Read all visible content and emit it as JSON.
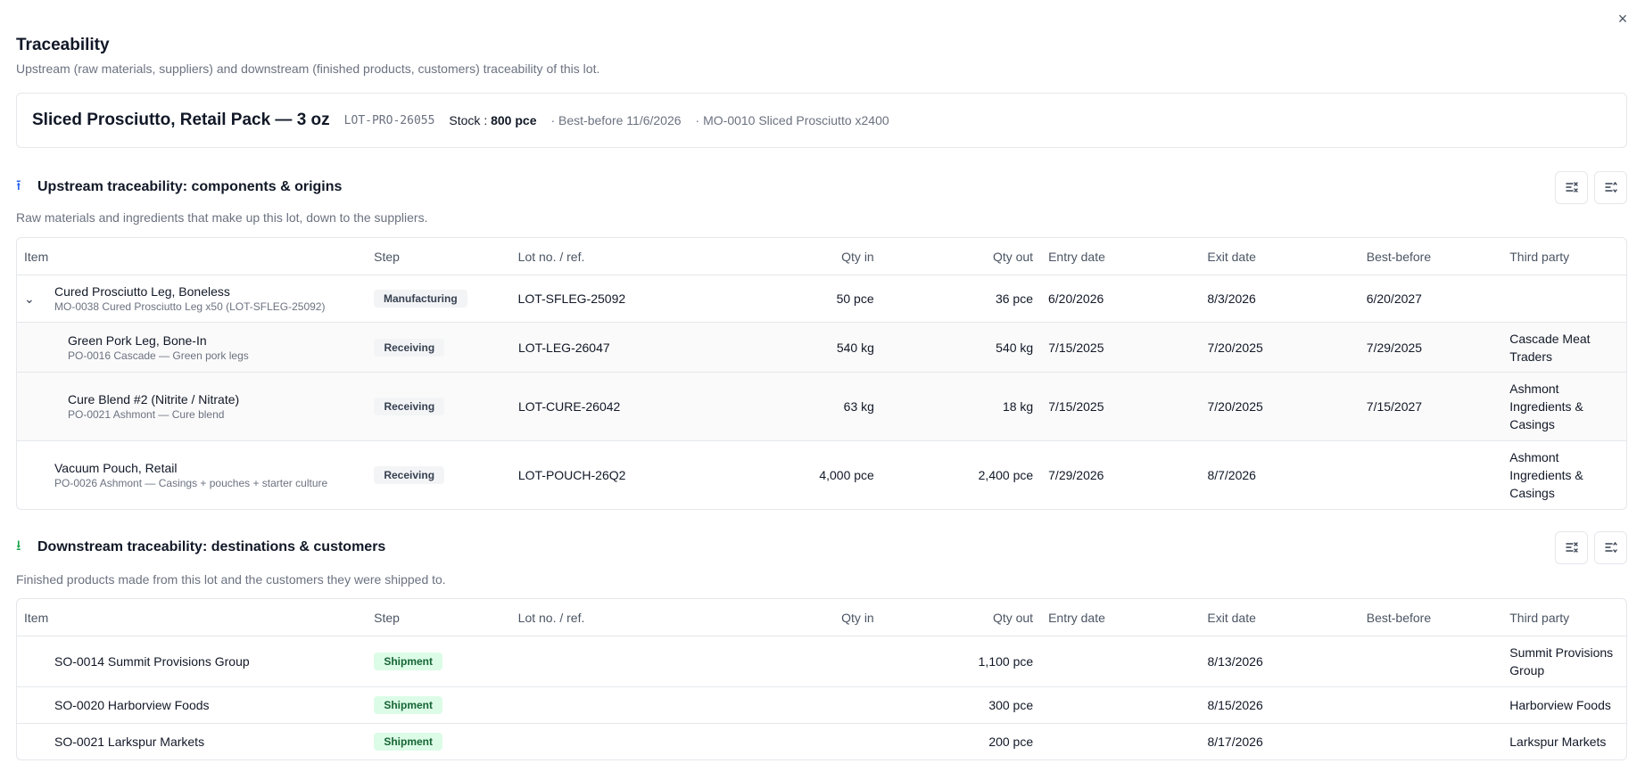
{
  "dialog": {
    "title": "Traceability",
    "subtitle": "Upstream (raw materials, suppliers) and downstream (finished products, customers) traceability of this lot.",
    "close_label": "×"
  },
  "lot": {
    "name": "Sliced Prosciutto, Retail Pack — 3 oz",
    "code": "LOT-PRO-26055",
    "stock_label": "Stock :",
    "stock_value": "800 pce",
    "best_before": "· Best-before 11/6/2026",
    "mo": "· MO-0010 Sliced Prosciutto x2400"
  },
  "columns": {
    "item": "Item",
    "step": "Step",
    "lot": "Lot no. / ref.",
    "qty_in": "Qty in",
    "qty_out": "Qty out",
    "entry": "Entry date",
    "exit": "Exit date",
    "best_before": "Best-before",
    "third_party": "Third party"
  },
  "upstream": {
    "icon": "arrow-up-icon",
    "title": "Upstream traceability: components & origins",
    "desc": "Raw materials and ingredients that make up this lot, down to the suppliers.",
    "rows": [
      {
        "name": "Cured Prosciutto Leg, Boneless",
        "sub": "MO-0038 Cured Prosciutto Leg x50 (LOT-SFLEG-25092)",
        "step": "Manufacturing",
        "lot": "LOT-SFLEG-25092",
        "qty_in": "50 pce",
        "qty_out": "36 pce",
        "entry": "6/20/2026",
        "exit": "8/3/2026",
        "best_before": "6/20/2027",
        "third_party": ""
      },
      {
        "name": "Green Pork Leg, Bone-In",
        "sub": "PO-0016 Cascade — Green pork legs",
        "step": "Receiving",
        "lot": "LOT-LEG-26047",
        "qty_in": "540 kg",
        "qty_out": "540 kg",
        "entry": "7/15/2025",
        "exit": "7/20/2025",
        "best_before": "7/29/2025",
        "third_party": "Cascade Meat Traders"
      },
      {
        "name": "Cure Blend #2 (Nitrite / Nitrate)",
        "sub": "PO-0021 Ashmont — Cure blend",
        "step": "Receiving",
        "lot": "LOT-CURE-26042",
        "qty_in": "63 kg",
        "qty_out": "18 kg",
        "entry": "7/15/2025",
        "exit": "7/20/2025",
        "best_before": "7/15/2027",
        "third_party": "Ashmont Ingredients & Casings"
      },
      {
        "name": "Vacuum Pouch, Retail",
        "sub": "PO-0026 Ashmont — Casings + pouches + starter culture",
        "step": "Receiving",
        "lot": "LOT-POUCH-26Q2",
        "qty_in": "4,000 pce",
        "qty_out": "2,400 pce",
        "entry": "7/29/2026",
        "exit": "8/7/2026",
        "best_before": "",
        "third_party": "Ashmont Ingredients & Casings"
      }
    ]
  },
  "downstream": {
    "icon": "arrow-down-icon",
    "title": "Downstream traceability: destinations & customers",
    "desc": "Finished products made from this lot and the customers they were shipped to.",
    "rows": [
      {
        "name": "SO-0014 Summit Provisions Group",
        "step": "Shipment",
        "qty_out": "1,100 pce",
        "exit": "8/13/2026",
        "third_party": "Summit Provisions Group"
      },
      {
        "name": "SO-0020 Harborview Foods",
        "step": "Shipment",
        "qty_out": "300 pce",
        "exit": "8/15/2026",
        "third_party": "Harborview Foods"
      },
      {
        "name": "SO-0021 Larkspur Markets",
        "step": "Shipment",
        "qty_out": "200 pce",
        "exit": "8/17/2026",
        "third_party": "Larkspur Markets"
      }
    ]
  },
  "glyphs": {
    "chevron": "⌄",
    "arrow_up": "⭱",
    "arrow_down": "⭳"
  }
}
